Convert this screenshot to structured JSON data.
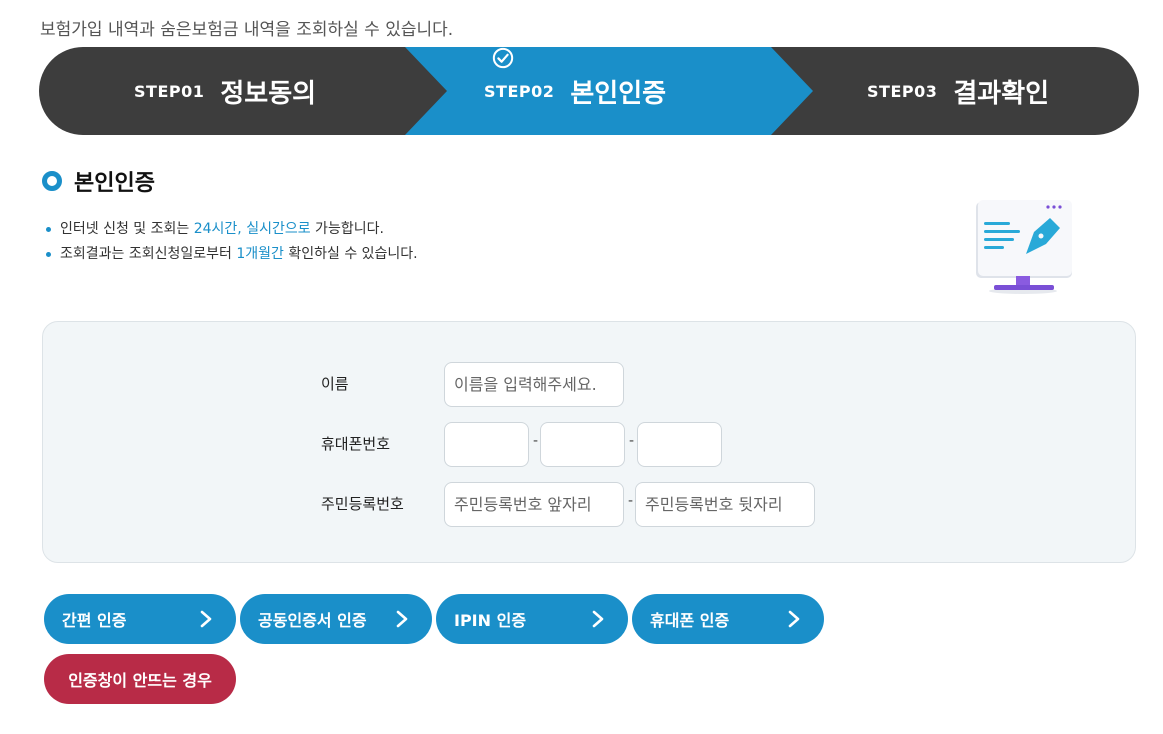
{
  "intro": "보험가입 내역과 숨은보험금 내역을 조회하실 수 있습니다.",
  "colors": {
    "dark": "#3d3d3d",
    "accent": "#1a8fc9",
    "red": "#b82b47"
  },
  "steps": [
    {
      "num": "STEP01",
      "title": "정보동의",
      "active": false
    },
    {
      "num": "STEP02",
      "title": "본인인증",
      "active": true,
      "icon": "check-circle-icon"
    },
    {
      "num": "STEP03",
      "title": "결과확인",
      "active": false
    }
  ],
  "section": {
    "title": "본인인증"
  },
  "notes": [
    {
      "before": "인터넷 신청 및 조회는 ",
      "highlight": "24시간, 실시간으로",
      "after": " 가능합니다."
    },
    {
      "before": "조회결과는 조회신청일로부터 ",
      "highlight": "1개월간",
      "after": " 확인하실 수 있습니다."
    }
  ],
  "form": {
    "name_label": "이름",
    "name_placeholder": "이름을 입력해주세요.",
    "phone_label": "휴대폰번호",
    "phone_sep": "-",
    "rrn_label": "주민등록번호",
    "rrn_front_placeholder": "주민등록번호 앞자리",
    "rrn_back_placeholder": "주민등록번호 뒷자리",
    "rrn_sep": "-"
  },
  "buttons": {
    "simple": "간편 인증",
    "cert": "공동인증서 인증",
    "ipin": "IPIN 인증",
    "phone": "휴대폰 인증",
    "help": "인증창이 안뜨는 경우"
  }
}
